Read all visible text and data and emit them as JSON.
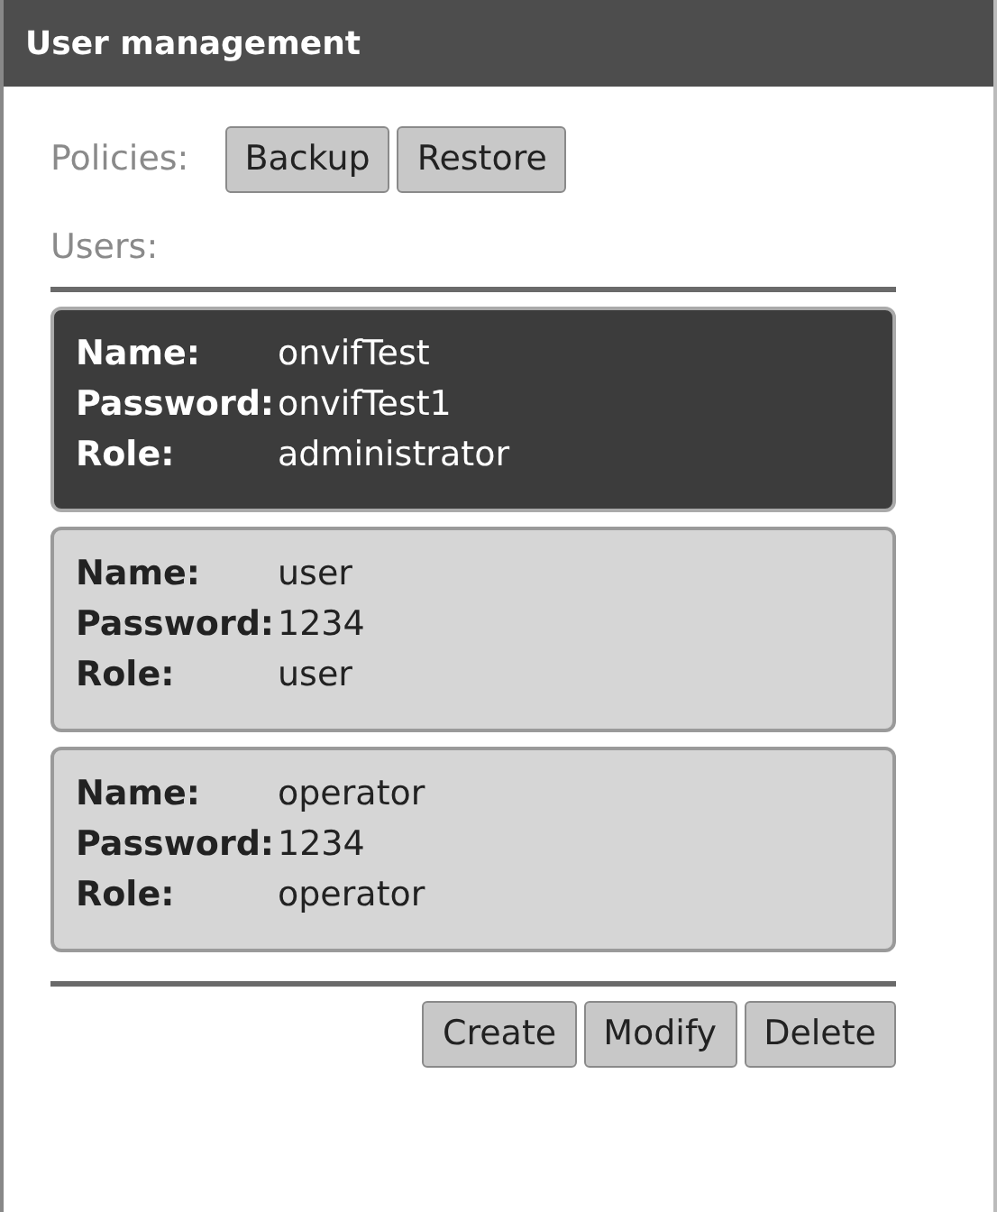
{
  "panel": {
    "title": "User management"
  },
  "policies": {
    "label": "Policies:",
    "buttons": [
      "Backup",
      "Restore"
    ]
  },
  "users_label": "Users:",
  "users": [
    {
      "selected": true,
      "fields": [
        {
          "label": "Name:",
          "value": "onvifTest"
        },
        {
          "label": "Password:",
          "value": "onvifTest1"
        },
        {
          "label": "Role:",
          "value": "administrator"
        }
      ]
    },
    {
      "selected": false,
      "fields": [
        {
          "label": "Name:",
          "value": "user"
        },
        {
          "label": "Password:",
          "value": "1234"
        },
        {
          "label": "Role:",
          "value": "user"
        }
      ]
    },
    {
      "selected": false,
      "fields": [
        {
          "label": "Name:",
          "value": "operator"
        },
        {
          "label": "Password:",
          "value": "1234"
        },
        {
          "label": "Role:",
          "value": "operator"
        }
      ]
    }
  ],
  "actions": [
    "Create",
    "Modify",
    "Delete"
  ]
}
